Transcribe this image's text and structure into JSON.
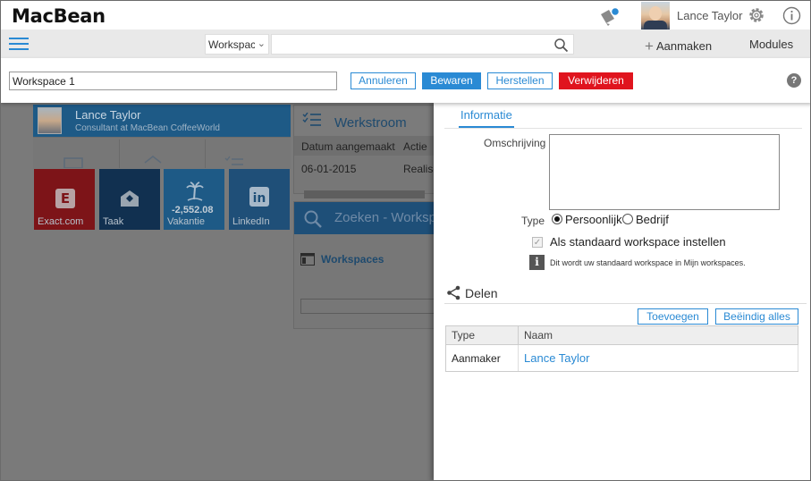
{
  "app": {
    "logo": "MacBean"
  },
  "user": {
    "name": "Lance Taylor"
  },
  "nav": {
    "scope_value": "Workspace",
    "search_value": "",
    "create_label": "Aanmaken",
    "modules_label": "Modules"
  },
  "toolbar": {
    "workspace_name": "Workspace 1",
    "cancel_label": "Annuleren",
    "save_label": "Bewaren",
    "restore_label": "Herstellen",
    "delete_label": "Verwijderen",
    "help_label": "?"
  },
  "background": {
    "profile": {
      "name": "Lance Taylor",
      "subtitle": "Consultant at MacBean CoffeeWorld"
    },
    "tiles": [
      {
        "label": "Exact.com",
        "color": "#7d1418"
      },
      {
        "label": "Taak",
        "color": "#113050"
      },
      {
        "label": "Vakantie",
        "value": "-2,552.08",
        "color": "#1e5a86"
      },
      {
        "label": "LinkedIn",
        "color": "#1f4f78"
      }
    ],
    "werkstroom": {
      "title": "Werkstroom",
      "columns": [
        "Datum aangemaakt",
        "Actie"
      ],
      "rows": [
        {
          "date": "06-01-2015",
          "action": "Realise"
        }
      ]
    },
    "zoeken": {
      "title": "Zoeken - Workspaces",
      "link": "Workspaces"
    }
  },
  "details": {
    "tab_info": "Informatie",
    "description_label": "Omschrijving",
    "description_value": "",
    "type_label": "Type",
    "type_options": [
      "Persoonlijk",
      "Bedrijf"
    ],
    "type_selected": "Persoonlijk",
    "default_checkbox_label": "Als standaard workspace instellen",
    "default_checked": true,
    "note_icon": "i",
    "note_text": "Dit wordt uw standaard workspace in Mijn workspaces.",
    "share": {
      "title": "Delen",
      "add_label": "Toevoegen",
      "end_all_label": "Beëindig alles",
      "columns": [
        "Type",
        "Naam"
      ],
      "rows": [
        {
          "type": "Aanmaker",
          "name": "Lance Taylor"
        }
      ]
    }
  },
  "colors": {
    "accent": "#2a8ad4",
    "danger": "#e0141e"
  }
}
